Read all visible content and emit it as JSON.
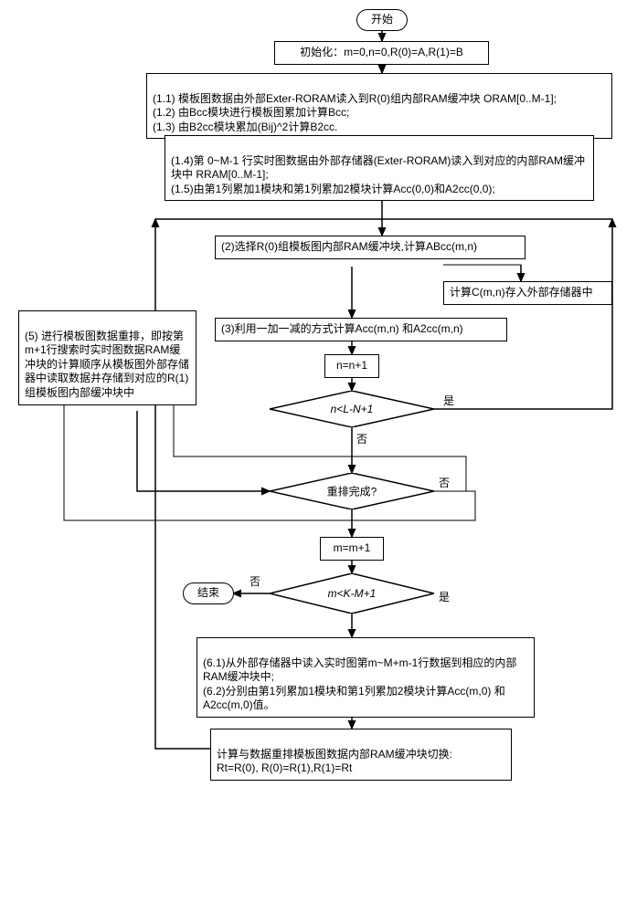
{
  "nodes": {
    "start": "开始",
    "init": "初始化：m=0,n=0,R(0)=A,R(1)=B",
    "step1_1": "(1.1) 模板图数据由外部Exter-RORAM读入到R(0)组内部RAM缓冲块 ORAM[0..M-1];\n(1.2) 由Bcc模块进行模板图累加计算Bcc;\n(1.3) 由B2cc模块累加(Bij)^2计算B2cc.",
    "step1_4": "(1.4)第 0~M-1 行实时图数据由外部存储器(Exter-RORAM)读入到对应的内部RAM缓冲块中 RRAM[0..M-1];\n(1.5)由第1列累加1模块和第1列累加2模块计算Acc(0,0)和A2cc(0,0);",
    "step2": "(2)选择R(0)组模板图内部RAM缓冲块,计算ABcc(m,n)",
    "step2b": "计算C(m,n)存入外部存储器中",
    "step3": "(3)利用一加一减的方式计算Acc(m,n) 和A2cc(m,n)",
    "incN": "n=n+1",
    "condN": "n<L-N+1",
    "step5": "(5) 进行模板图数据重排，即按第m+1行搜索时实时图数据RAM缓冲块的计算顺序从模板图外部存储器中读取数据并存储到对应的R(1)组模板图内部缓冲块中",
    "condReorder": "重排完成?",
    "incM": "m=m+1",
    "condM": "m<K-M+1",
    "end": "结束",
    "step6": "(6.1)从外部存储器中读入实时图第m~M+m-1行数据到相应的内部RAM缓冲块中;\n(6.2)分别由第1列累加1模块和第1列累加2模块计算Acc(m,0) 和A2cc(m,0)值。",
    "step7": "计算与数据重排模板图数据内部RAM缓冲块切换:\nRt=R(0), R(0)=R(1),R(1)=Rt"
  },
  "labels": {
    "yes": "是",
    "no": "否"
  }
}
